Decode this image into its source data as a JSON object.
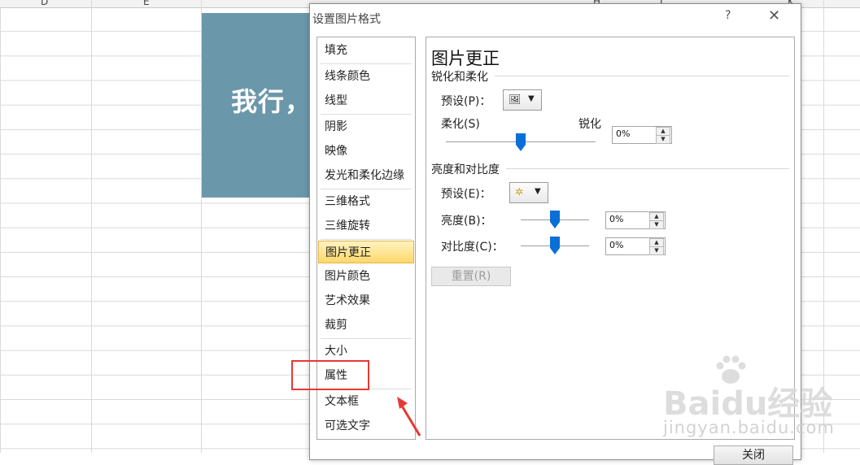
{
  "sheet": {
    "columns": [
      "D",
      "E",
      "H",
      "I",
      "K"
    ],
    "image_text": "我行，"
  },
  "dialog": {
    "title": "设置图片格式",
    "help": "?",
    "close_label": "关闭"
  },
  "nav": {
    "items": [
      {
        "label": "填充"
      },
      {
        "label": "线条颜色"
      },
      {
        "label": "线型"
      },
      {
        "label": "阴影"
      },
      {
        "label": "映像"
      },
      {
        "label": "发光和柔化边缘"
      },
      {
        "label": "三维格式"
      },
      {
        "label": "三维旋转"
      },
      {
        "label": "图片更正",
        "active": true
      },
      {
        "label": "图片颜色"
      },
      {
        "label": "艺术效果"
      },
      {
        "label": "裁剪"
      },
      {
        "label": "大小"
      },
      {
        "label": "属性"
      },
      {
        "label": "文本框"
      },
      {
        "label": "可选文字"
      }
    ]
  },
  "panel": {
    "title": "图片更正",
    "sharpen": {
      "heading": "锐化和柔化",
      "preset_label": "预设(P)：",
      "soften_label": "柔化(S)",
      "sharpen_label": "锐化",
      "value": "0%",
      "slider_level": 0.5
    },
    "brightness_contrast": {
      "heading": "亮度和对比度",
      "preset_label": "预设(E)：",
      "brightness_label": "亮度(B)：",
      "brightness_value": "0%",
      "brightness_level": 0.5,
      "contrast_label": "对比度(C)：",
      "contrast_value": "0%",
      "contrast_level": 0.5
    },
    "reset_label": "重置(R)"
  },
  "colors": {
    "accent_blue": "#0a6fd6",
    "active_nav": "#fdd86a",
    "highlight_red": "#e53935",
    "image_bg": "#6b97ab"
  },
  "watermark": {
    "brand": "Baidu经验",
    "url": "jingyan.baidu.com"
  }
}
